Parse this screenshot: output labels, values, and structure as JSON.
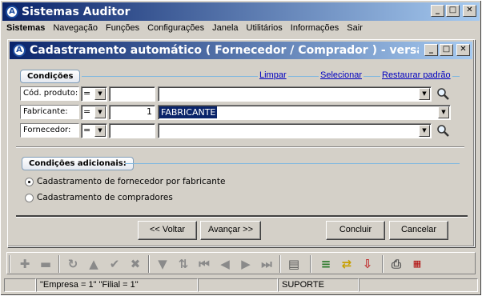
{
  "app": {
    "title": "Sistemas Auditor",
    "icon": "A"
  },
  "menu": [
    "Sistemas",
    "Navegação",
    "Funções",
    "Configurações",
    "Janela",
    "Utilitários",
    "Informações",
    "Sair"
  ],
  "child": {
    "title": "Cadastramento automático ( Fornecedor / Comprador ) - versã..."
  },
  "conditions": {
    "header": "Condições",
    "links": {
      "clear": "Limpar",
      "select": "Selecionar",
      "restore": "Restaurar padrão"
    },
    "rows": [
      {
        "label": "Cód. produto:",
        "op": "=",
        "value": "",
        "desc": ""
      },
      {
        "label": "Fabricante:",
        "op": "=",
        "value": "1",
        "desc": "FABRICANTE"
      },
      {
        "label": "Fornecedor:",
        "op": "=",
        "value": "",
        "desc": ""
      }
    ]
  },
  "additional": {
    "header": "Condições adicionais:",
    "options": [
      {
        "label": "Cadastramento de fornecedor por fabricante",
        "selected": true
      },
      {
        "label": "Cadastramento de compradores",
        "selected": false
      }
    ]
  },
  "buttons": {
    "back": "<< Voltar",
    "next": "Avançar >>",
    "finish": "Concluir",
    "cancel": "Cancelar"
  },
  "toolbar_icons": [
    "add-icon",
    "remove-icon",
    "refresh-icon",
    "up-icon",
    "check-icon",
    "cancel-x-icon",
    "filter-icon",
    "sort-icon",
    "first-icon",
    "prev-icon",
    "next-icon",
    "last-icon",
    "report-icon",
    "list-icon",
    "transfer-icon",
    "export-icon",
    "print-icon",
    "pdf-icon"
  ],
  "status": {
    "company": "\"Empresa = 1\"   \"Filial = 1\"",
    "user": "SUPORTE"
  }
}
